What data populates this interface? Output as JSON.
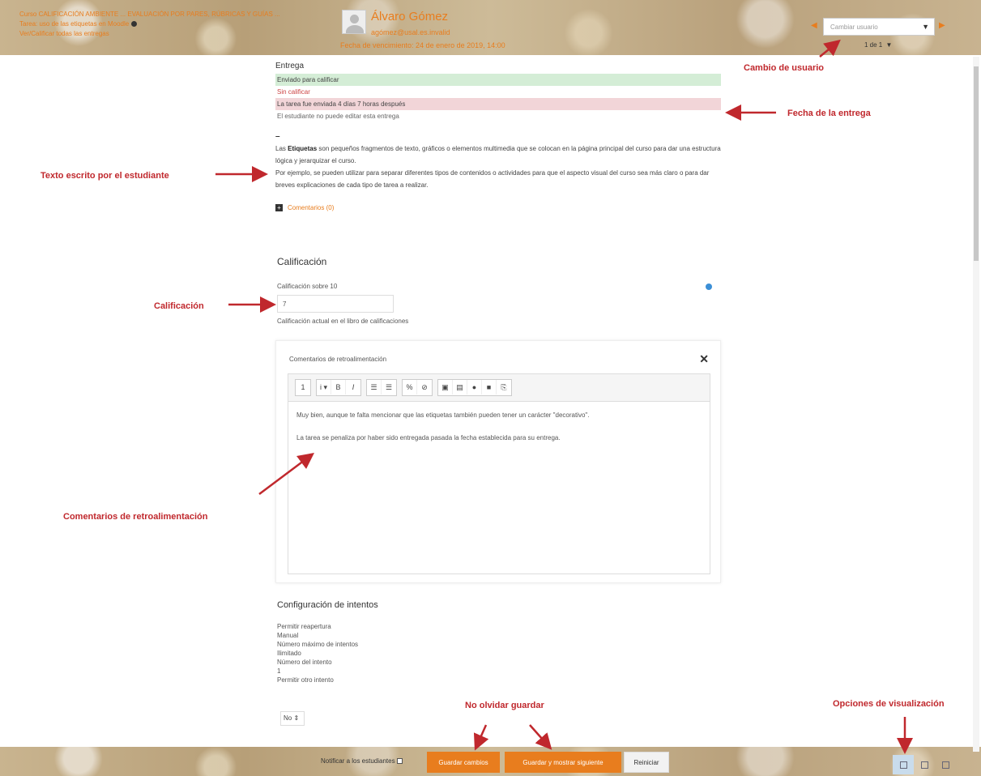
{
  "header": {
    "course_title": "Curso CALIFICACIÓN AMBIENTE ... EVALUACIÓN POR PARES, RÚBRICAS Y GUÍAS ...",
    "assignment_link": "Tarea: uso de las etiquetas en Moodle",
    "view_all_link": "Ver/Calificar todas las entregas",
    "student_name": "Álvaro Gómez",
    "student_email": "agómez@usal.es.invalid",
    "due_date": "Fecha de vencimiento: 24 de enero de 2019, 14:00",
    "user_select_placeholder": "Cambiar usuario",
    "pager": "1 de 1"
  },
  "submission": {
    "label": "Entrega",
    "status_submitted": "Enviado para calificar",
    "status_grading": "Sin calificar",
    "status_late": "La tarea fue enviada 4 días 7 horas después",
    "status_edit": "El estudiante no puede editar esta entrega",
    "dash": "–",
    "text_intro": "Las",
    "text_bold": "Etiquetas",
    "text_rest": "son pequeños fragmentos de texto, gráficos o elementos multimedia que se colocan en la página principal del curso para dar una estructura lógica y jerarquizar el curso.",
    "text_p2": "Por ejemplo, se pueden utilizar para separar diferentes tipos de contenidos o actividades para que el aspecto visual del curso sea más claro o para dar breves explicaciones de cada tipo de tarea a realizar.",
    "comments_link": "Comentarios (0)"
  },
  "grade": {
    "heading": "Calificación",
    "out_of": "Calificación sobre 10",
    "value": "7",
    "gradebook_label": "Calificación actual en el libro de calificaciones"
  },
  "feedback": {
    "title": "Comentarios de retroalimentación",
    "toolbar": [
      "1",
      "i ▾",
      "B",
      "I",
      "☰",
      "☰",
      "%",
      "⊘",
      "▣",
      "▤",
      "●",
      "■",
      "⎘"
    ],
    "p1": "Muy bien, aunque te falta mencionar que las etiquetas también pueden tener un carácter \"decorativo\".",
    "p2": "La tarea se penaliza por haber sido entregada pasada la fecha establecida para su entrega."
  },
  "attempts": {
    "heading": "Configuración de intentos",
    "items": [
      "Permitir reapertura",
      "Manual",
      "Número máximo de intentos",
      "Ilimitado",
      "Número del intento",
      "1",
      "Permitir otro intento"
    ],
    "select_value": "No"
  },
  "footer": {
    "notify_label": "Notificar a los estudiantes",
    "save_label": "Guardar cambios",
    "save_next_label": "Guardar y mostrar siguiente",
    "reset_label": "Reiniciar"
  },
  "annotations": {
    "user_change": "Cambio de usuario",
    "submission_date": "Fecha de la entrega",
    "student_text": "Texto escrito por el estudiante",
    "grade": "Calificación",
    "feedback": "Comentarios de retroalimentación",
    "save": "No olvidar guardar",
    "view_options": "Opciones de visualización"
  },
  "colors": {
    "accent": "#e87d1e",
    "annotation": "#c0282d",
    "status_green": "#d4edd6",
    "status_red": "#f2d5d8"
  },
  "icons": [
    "info-icon",
    "avatar-icon",
    "prev-user-icon",
    "next-user-icon",
    "filter-icon",
    "plus-icon",
    "help-icon",
    "close-icon",
    "collapse-view-icon",
    "default-view-icon",
    "expand-view-icon"
  ]
}
